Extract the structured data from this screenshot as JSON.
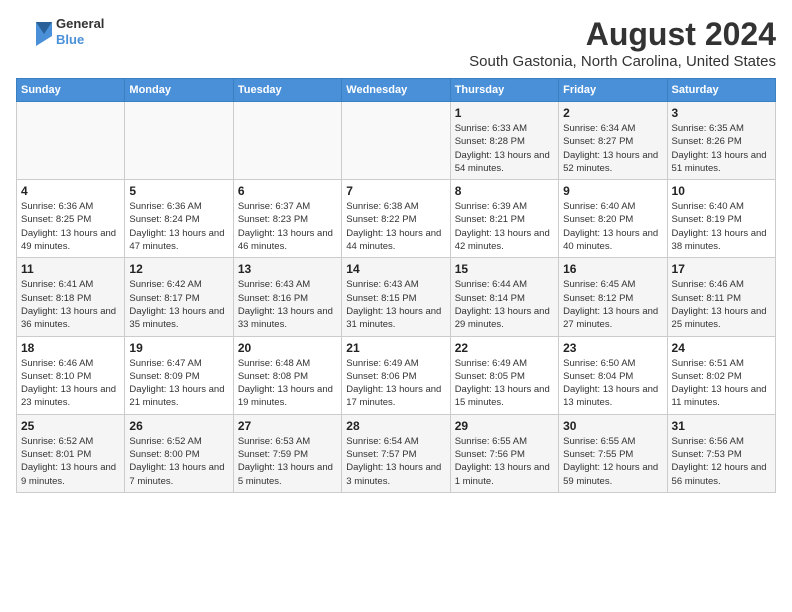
{
  "logo": {
    "line1": "General",
    "line2": "Blue"
  },
  "title": "August 2024",
  "subtitle": "South Gastonia, North Carolina, United States",
  "days_of_week": [
    "Sunday",
    "Monday",
    "Tuesday",
    "Wednesday",
    "Thursday",
    "Friday",
    "Saturday"
  ],
  "weeks": [
    [
      {
        "day": "",
        "info": ""
      },
      {
        "day": "",
        "info": ""
      },
      {
        "day": "",
        "info": ""
      },
      {
        "day": "",
        "info": ""
      },
      {
        "day": "1",
        "info": "Sunrise: 6:33 AM\nSunset: 8:28 PM\nDaylight: 13 hours and 54 minutes."
      },
      {
        "day": "2",
        "info": "Sunrise: 6:34 AM\nSunset: 8:27 PM\nDaylight: 13 hours and 52 minutes."
      },
      {
        "day": "3",
        "info": "Sunrise: 6:35 AM\nSunset: 8:26 PM\nDaylight: 13 hours and 51 minutes."
      }
    ],
    [
      {
        "day": "4",
        "info": "Sunrise: 6:36 AM\nSunset: 8:25 PM\nDaylight: 13 hours and 49 minutes."
      },
      {
        "day": "5",
        "info": "Sunrise: 6:36 AM\nSunset: 8:24 PM\nDaylight: 13 hours and 47 minutes."
      },
      {
        "day": "6",
        "info": "Sunrise: 6:37 AM\nSunset: 8:23 PM\nDaylight: 13 hours and 46 minutes."
      },
      {
        "day": "7",
        "info": "Sunrise: 6:38 AM\nSunset: 8:22 PM\nDaylight: 13 hours and 44 minutes."
      },
      {
        "day": "8",
        "info": "Sunrise: 6:39 AM\nSunset: 8:21 PM\nDaylight: 13 hours and 42 minutes."
      },
      {
        "day": "9",
        "info": "Sunrise: 6:40 AM\nSunset: 8:20 PM\nDaylight: 13 hours and 40 minutes."
      },
      {
        "day": "10",
        "info": "Sunrise: 6:40 AM\nSunset: 8:19 PM\nDaylight: 13 hours and 38 minutes."
      }
    ],
    [
      {
        "day": "11",
        "info": "Sunrise: 6:41 AM\nSunset: 8:18 PM\nDaylight: 13 hours and 36 minutes."
      },
      {
        "day": "12",
        "info": "Sunrise: 6:42 AM\nSunset: 8:17 PM\nDaylight: 13 hours and 35 minutes."
      },
      {
        "day": "13",
        "info": "Sunrise: 6:43 AM\nSunset: 8:16 PM\nDaylight: 13 hours and 33 minutes."
      },
      {
        "day": "14",
        "info": "Sunrise: 6:43 AM\nSunset: 8:15 PM\nDaylight: 13 hours and 31 minutes."
      },
      {
        "day": "15",
        "info": "Sunrise: 6:44 AM\nSunset: 8:14 PM\nDaylight: 13 hours and 29 minutes."
      },
      {
        "day": "16",
        "info": "Sunrise: 6:45 AM\nSunset: 8:12 PM\nDaylight: 13 hours and 27 minutes."
      },
      {
        "day": "17",
        "info": "Sunrise: 6:46 AM\nSunset: 8:11 PM\nDaylight: 13 hours and 25 minutes."
      }
    ],
    [
      {
        "day": "18",
        "info": "Sunrise: 6:46 AM\nSunset: 8:10 PM\nDaylight: 13 hours and 23 minutes."
      },
      {
        "day": "19",
        "info": "Sunrise: 6:47 AM\nSunset: 8:09 PM\nDaylight: 13 hours and 21 minutes."
      },
      {
        "day": "20",
        "info": "Sunrise: 6:48 AM\nSunset: 8:08 PM\nDaylight: 13 hours and 19 minutes."
      },
      {
        "day": "21",
        "info": "Sunrise: 6:49 AM\nSunset: 8:06 PM\nDaylight: 13 hours and 17 minutes."
      },
      {
        "day": "22",
        "info": "Sunrise: 6:49 AM\nSunset: 8:05 PM\nDaylight: 13 hours and 15 minutes."
      },
      {
        "day": "23",
        "info": "Sunrise: 6:50 AM\nSunset: 8:04 PM\nDaylight: 13 hours and 13 minutes."
      },
      {
        "day": "24",
        "info": "Sunrise: 6:51 AM\nSunset: 8:02 PM\nDaylight: 13 hours and 11 minutes."
      }
    ],
    [
      {
        "day": "25",
        "info": "Sunrise: 6:52 AM\nSunset: 8:01 PM\nDaylight: 13 hours and 9 minutes."
      },
      {
        "day": "26",
        "info": "Sunrise: 6:52 AM\nSunset: 8:00 PM\nDaylight: 13 hours and 7 minutes."
      },
      {
        "day": "27",
        "info": "Sunrise: 6:53 AM\nSunset: 7:59 PM\nDaylight: 13 hours and 5 minutes."
      },
      {
        "day": "28",
        "info": "Sunrise: 6:54 AM\nSunset: 7:57 PM\nDaylight: 13 hours and 3 minutes."
      },
      {
        "day": "29",
        "info": "Sunrise: 6:55 AM\nSunset: 7:56 PM\nDaylight: 13 hours and 1 minute."
      },
      {
        "day": "30",
        "info": "Sunrise: 6:55 AM\nSunset: 7:55 PM\nDaylight: 12 hours and 59 minutes."
      },
      {
        "day": "31",
        "info": "Sunrise: 6:56 AM\nSunset: 7:53 PM\nDaylight: 12 hours and 56 minutes."
      }
    ]
  ]
}
